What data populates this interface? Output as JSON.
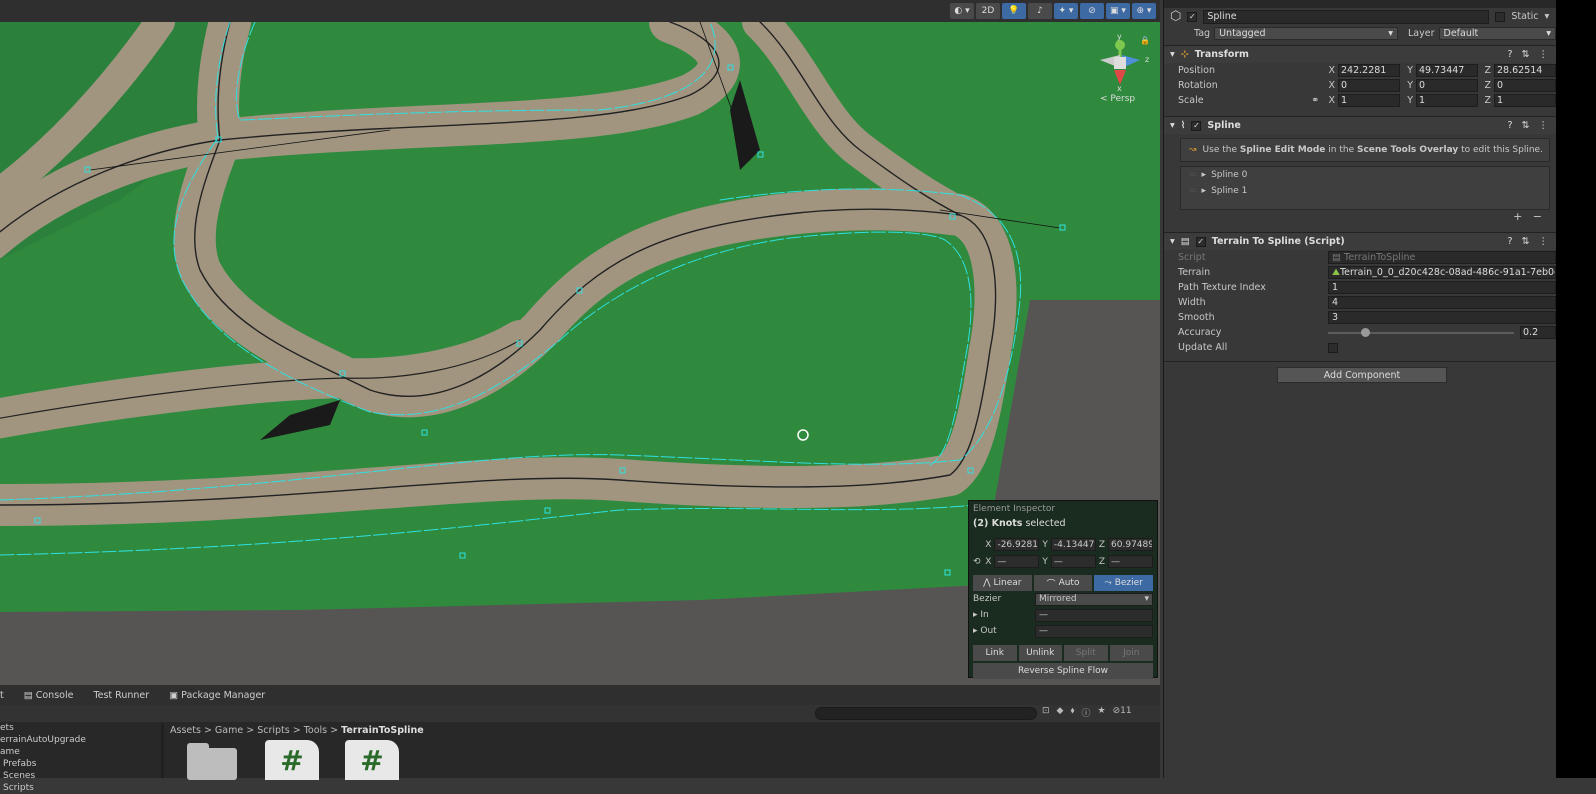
{
  "scene": {
    "toolbar": {
      "mode2d": "2D"
    },
    "gizmo": {
      "persp": "< Persp",
      "axis_y": "y",
      "axis_z": "z",
      "axis_x": "x"
    }
  },
  "element_inspector": {
    "title": "Element Inspector",
    "selection_count": "(2) Knots",
    "selection_suffix": " selected",
    "pos": {
      "x_label": "X",
      "x": "-26.92812",
      "y_label": "Y",
      "y": "-4.134476",
      "z_label": "Z",
      "z": "60.97489"
    },
    "rot": {
      "x_label": "X",
      "x": "—",
      "y_label": "Y",
      "y": "—",
      "z_label": "Z",
      "z": "—"
    },
    "tangent_modes": [
      "Linear",
      "Auto",
      "Bezier"
    ],
    "bezier_label": "Bezier",
    "bezier_value": "Mirrored",
    "in_label": "In",
    "in_value": "—",
    "out_label": "Out",
    "out_value": "—",
    "buttons": [
      "Link",
      "Unlink",
      "Split",
      "Join"
    ],
    "reverse": "Reverse Spline Flow"
  },
  "bottom": {
    "tabs": [
      "t",
      "Console",
      "Test Runner",
      "Package Manager"
    ],
    "hidden_count": "11",
    "tree": [
      "ets",
      "errainAutoUpgrade",
      "ame",
      "Prefabs",
      "Scenes",
      "Scripts"
    ],
    "breadcrumb": [
      "Assets",
      "Game",
      "Scripts",
      "Tools"
    ],
    "breadcrumb_current": "TerrainToSpline"
  },
  "inspector": {
    "object_name": "Spline",
    "static_label": "Static",
    "tag_label": "Tag",
    "tag_value": "Untagged",
    "layer_label": "Layer",
    "layer_value": "Default",
    "transform": {
      "title": "Transform",
      "position_label": "Position",
      "position": {
        "x": "242.2281",
        "y": "49.73447",
        "z": "28.62514"
      },
      "rotation_label": "Rotation",
      "rotation": {
        "x": "0",
        "y": "0",
        "z": "0"
      },
      "scale_label": "Scale",
      "scale": {
        "x": "1",
        "y": "1",
        "z": "1"
      }
    },
    "spline": {
      "title": "Spline",
      "help_pre": "Use the ",
      "help_b1": "Spline Edit Mode",
      "help_mid": " in the ",
      "help_b2": "Scene Tools Overlay",
      "help_post": " to edit this Spline.",
      "items": [
        "Spline 0",
        "Spline 1"
      ],
      "add": "+",
      "remove": "−"
    },
    "terrain_to_spline": {
      "title": "Terrain To Spline (Script)",
      "script_label": "Script",
      "script_value": "TerrainToSpline",
      "terrain_label": "Terrain",
      "terrain_value": "Terrain_0_0_d20c428c-08ad-486c-91a1-7eb0c",
      "path_texture_label": "Path Texture Index",
      "path_texture_value": "1",
      "width_label": "Width",
      "width_value": "4",
      "smooth_label": "Smooth",
      "smooth_value": "3",
      "accuracy_label": "Accuracy",
      "accuracy_value": "0.2",
      "accuracy_fraction": 0.2,
      "update_all_label": "Update All"
    },
    "add_component": "Add Component"
  }
}
